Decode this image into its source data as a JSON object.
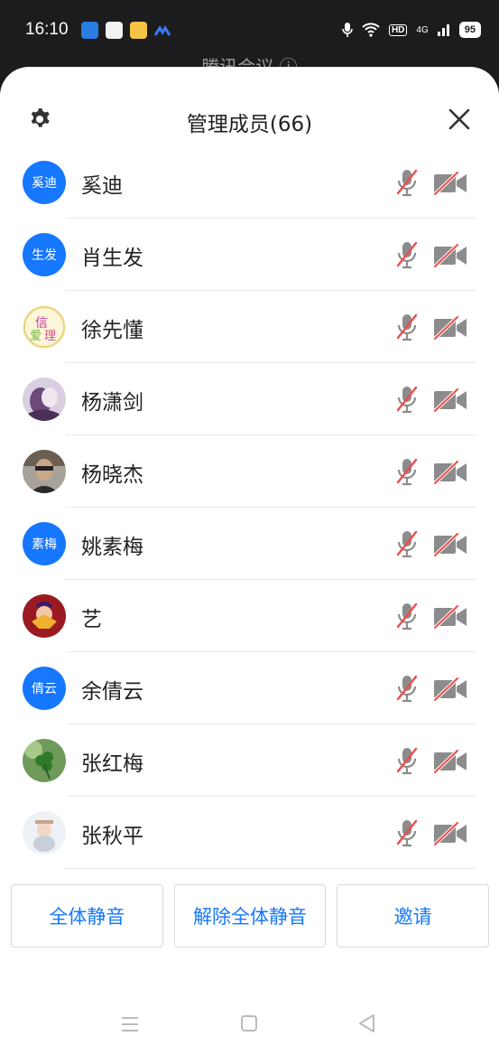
{
  "status_bar": {
    "time": "16:10",
    "network": "HD",
    "signal_label": "4G",
    "battery": "95"
  },
  "behind": {
    "title": "腾讯会议 ⓘ"
  },
  "header": {
    "title": "管理成员(66)",
    "settings_icon": "gear-icon",
    "close_icon": "close-icon"
  },
  "members": [
    {
      "name": "奚迪",
      "avatar_text": "奚迪",
      "avatar_type": "text"
    },
    {
      "name": "肖生发",
      "avatar_text": "生发",
      "avatar_type": "text"
    },
    {
      "name": "徐先懂",
      "avatar_text": "",
      "avatar_type": "image",
      "avatar_style": "pink-char"
    },
    {
      "name": "杨潇剑",
      "avatar_text": "",
      "avatar_type": "image",
      "avatar_style": "purple-portrait"
    },
    {
      "name": "杨晓杰",
      "avatar_text": "",
      "avatar_type": "image",
      "avatar_style": "man-portrait"
    },
    {
      "name": "姚素梅",
      "avatar_text": "素梅",
      "avatar_type": "text"
    },
    {
      "name": "艺",
      "avatar_text": "",
      "avatar_type": "image",
      "avatar_style": "red-art"
    },
    {
      "name": "余倩云",
      "avatar_text": "倩云",
      "avatar_type": "text"
    },
    {
      "name": "张红梅",
      "avatar_text": "",
      "avatar_type": "image",
      "avatar_style": "green-clover"
    },
    {
      "name": "张秋平",
      "avatar_text": "",
      "avatar_type": "image",
      "avatar_style": "baby-photo"
    }
  ],
  "actions": {
    "mute_all": "全体静音",
    "unmute_all": "解除全体静音",
    "invite": "邀请"
  },
  "colors": {
    "accent": "#1677ff",
    "muted_red": "#f04b4b",
    "icon_gray": "#8c8c8c"
  }
}
